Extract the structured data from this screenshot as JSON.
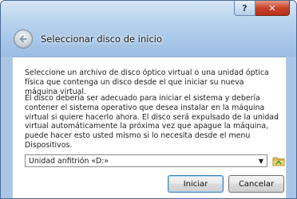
{
  "window": {
    "title": "Seleccionar disco de inicio",
    "help_label": "?",
    "close_label": "✕"
  },
  "content": {
    "paragraph1": "Seleccione un archivo de disco óptico virtual o una unidad óptica física que contenga un disco desde el que iniciar su nueva máquina virtual.",
    "paragraph2": "El disco debería ser adecuado para iniciar el sistema y debería contener el sistema operativo que desea instalar en la máquina virtual si quiere hacerlo ahora. El disco será expulsado de la unidad virtual automáticamente la próxima vez que apague la máquina, puede hacer esto usted mismo si lo necesita desde el menu Dispositivos."
  },
  "dropdown": {
    "selected": "Unidad anfitrión «D:»",
    "arrow": "▼"
  },
  "buttons": {
    "start": "Iniciar",
    "cancel": "Cancelar"
  },
  "icons": {
    "back": "back-arrow-icon",
    "folder": "folder-icon"
  }
}
